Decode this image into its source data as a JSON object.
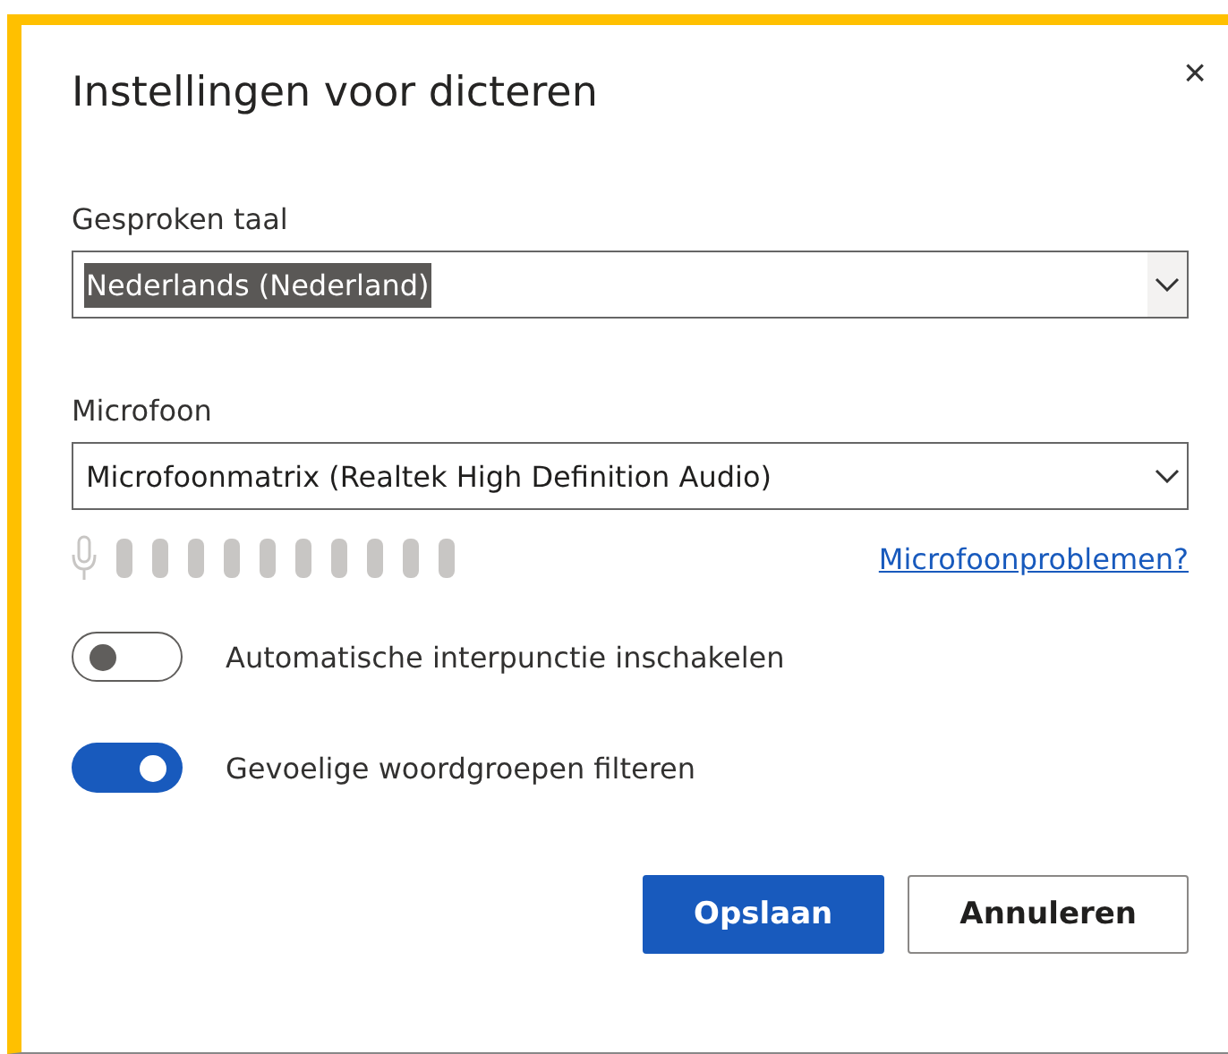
{
  "dialog": {
    "title": "Instellingen voor dicteren",
    "close": "×"
  },
  "fields": [
    {
      "label": "Gesproken taal",
      "value": "Nederlands (Nederland)",
      "text_selected": true
    },
    {
      "label": "Microfoon",
      "value": "Microfoonmatrix (Realtek High Definition Audio)",
      "text_selected": false
    }
  ],
  "meter": {
    "link": "Microfoonproblemen?"
  },
  "toggles": [
    {
      "label": "Automatische interpunctie inschakelen",
      "on": false
    },
    {
      "label": "Gevoelige woordgroepen filteren",
      "on": true
    }
  ],
  "buttons": [
    {
      "label": "Opslaan",
      "kind": "primary"
    },
    {
      "label": "Annuleren",
      "kind": "secondary"
    }
  ]
}
